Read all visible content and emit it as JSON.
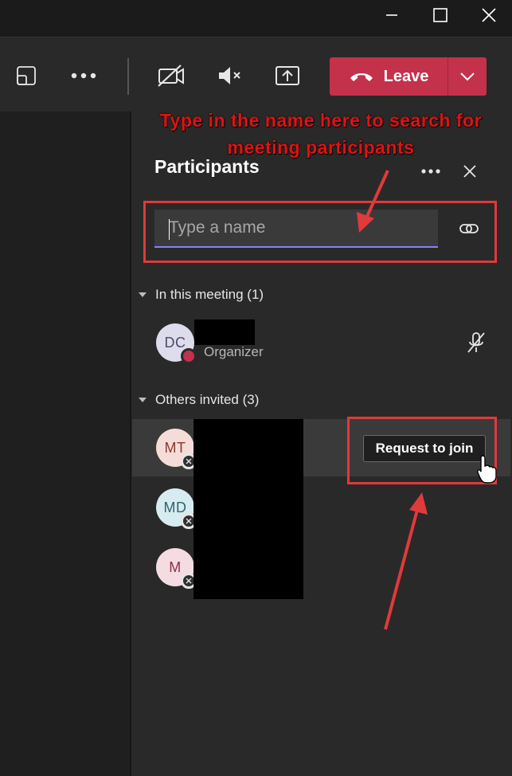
{
  "window": {
    "minimize": "—",
    "maximize": "☐",
    "close": "✕"
  },
  "toolbar": {
    "icons": [
      "pop-out-icon",
      "more-options-icon",
      "camera-off-icon",
      "speaker-muted-icon",
      "share-screen-icon"
    ],
    "leave_label": "Leave"
  },
  "annotation": {
    "text": "Type in the name here to search for meeting participants"
  },
  "participants": {
    "title": "Participants",
    "search": {
      "placeholder": "Type a name",
      "value": ""
    },
    "in_meeting": {
      "header": "In this meeting (1)",
      "members": [
        {
          "initials": "DC",
          "role": "Organizer",
          "avatar_color": "#dcdcec",
          "text_color": "#4b4b6b"
        }
      ]
    },
    "others_invited": {
      "header": "Others invited (3)",
      "members": [
        {
          "initials": "MT",
          "avatar_color": "#f6dcd8",
          "text_color": "#8a3b30"
        },
        {
          "initials": "MD",
          "avatar_color": "#d7ecf0",
          "text_color": "#2f6470"
        },
        {
          "initials": "M",
          "avatar_color": "#f5dce2",
          "text_color": "#8a3145"
        }
      ],
      "request_button": "Request to join"
    }
  },
  "colors": {
    "leave": "#c4314b",
    "accent": "#7f85f5",
    "annotation": "#e01212"
  }
}
